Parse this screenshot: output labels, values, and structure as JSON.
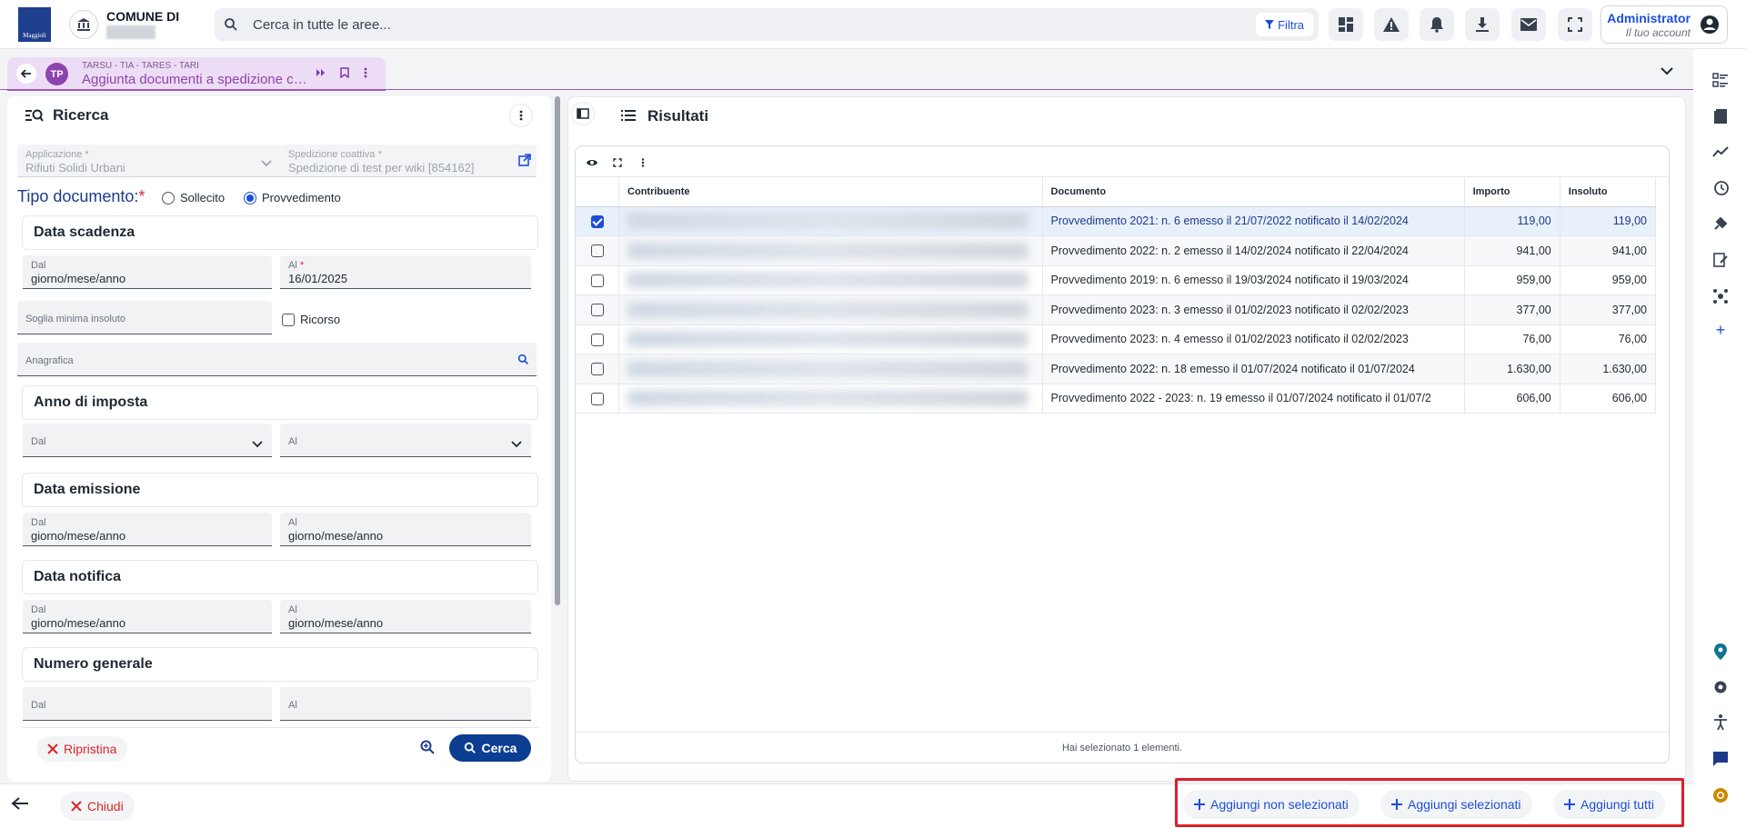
{
  "header": {
    "logo_text": "Maggioli",
    "comune_label": "COMUNE DI",
    "search_placeholder": "Cerca in tutte le aree...",
    "filter_label": "Filtra",
    "account_name": "Administrator",
    "account_sub": "Il tuo account"
  },
  "tab": {
    "module": "TARSU - TIA - TARES - TARI",
    "title": "Aggiunta documenti a spedizione coattiva"
  },
  "ricerca": {
    "title": "Ricerca",
    "applicazione_label": "Applicazione",
    "applicazione_value": "Rifiuti Solidi Urbani",
    "spedizione_label": "Spedizione coattiva",
    "spedizione_value": "Spedizione di test per wiki [854162]",
    "tipo_documento_label": "Tipo documento:",
    "radio_sollecito": "Sollecito",
    "radio_provvedimento": "Provvedimento",
    "data_scadenza": "Data scadenza",
    "dal_label": "Dal",
    "al_label": "Al",
    "date_placeholder": "giorno/mese/anno",
    "al_scadenza_value": "16/01/2025",
    "soglia_label": "Soglia minima insoluto",
    "ricorso_label": "Ricorso",
    "anagrafica_label": "Anagrafica",
    "anno_imposta": "Anno di imposta",
    "data_emissione": "Data emissione",
    "data_notifica": "Data notifica",
    "numero_generale": "Numero generale",
    "ripristina_label": "Ripristina",
    "cerca_label": "Cerca"
  },
  "risultati": {
    "title": "Risultati",
    "columns": [
      "Contribuente",
      "Documento",
      "Importo",
      "Insoluto"
    ],
    "rows": [
      {
        "documento": "Provvedimento 2021: n. 6 emesso il 21/07/2022 notificato il 14/02/2024",
        "importo": "119,00",
        "insoluto": "119,00",
        "selected": true
      },
      {
        "documento": "Provvedimento 2022: n. 2 emesso il 14/02/2024 notificato il 22/04/2024",
        "importo": "941,00",
        "insoluto": "941,00",
        "selected": false
      },
      {
        "documento": "Provvedimento 2019: n. 6 emesso il 19/03/2024 notificato il 19/03/2024",
        "importo": "959,00",
        "insoluto": "959,00",
        "selected": false
      },
      {
        "documento": "Provvedimento 2023: n. 3 emesso il 01/02/2023 notificato il 02/02/2023",
        "importo": "377,00",
        "insoluto": "377,00",
        "selected": false
      },
      {
        "documento": "Provvedimento 2023: n. 4 emesso il 01/02/2023 notificato il 02/02/2023",
        "importo": "76,00",
        "insoluto": "76,00",
        "selected": false
      },
      {
        "documento": "Provvedimento 2022: n. 18 emesso il 01/07/2024 notificato il 01/07/2024",
        "importo": "1.630,00",
        "insoluto": "1.630,00",
        "selected": false
      },
      {
        "documento": "Provvedimento 2022 - 2023: n. 19 emesso il 01/07/2024 notificato il 01/07/2",
        "importo": "606,00",
        "insoluto": "606,00",
        "selected": false
      }
    ],
    "footer": "Hai selezionato 1 elementi."
  },
  "footer": {
    "chiudi_label": "Chiudi",
    "aggiungi_non_selezionati": "Aggiungi non selezionati",
    "aggiungi_selezionati": "Aggiungi selezionati",
    "aggiungi_tutti": "Aggiungi tutti"
  },
  "colors": {
    "primary": "#0b3d91",
    "link_blue": "#1d4ed8",
    "danger": "#dc2626",
    "module_purple": "#8e44ad",
    "highlight_red": "#e11d2b"
  }
}
